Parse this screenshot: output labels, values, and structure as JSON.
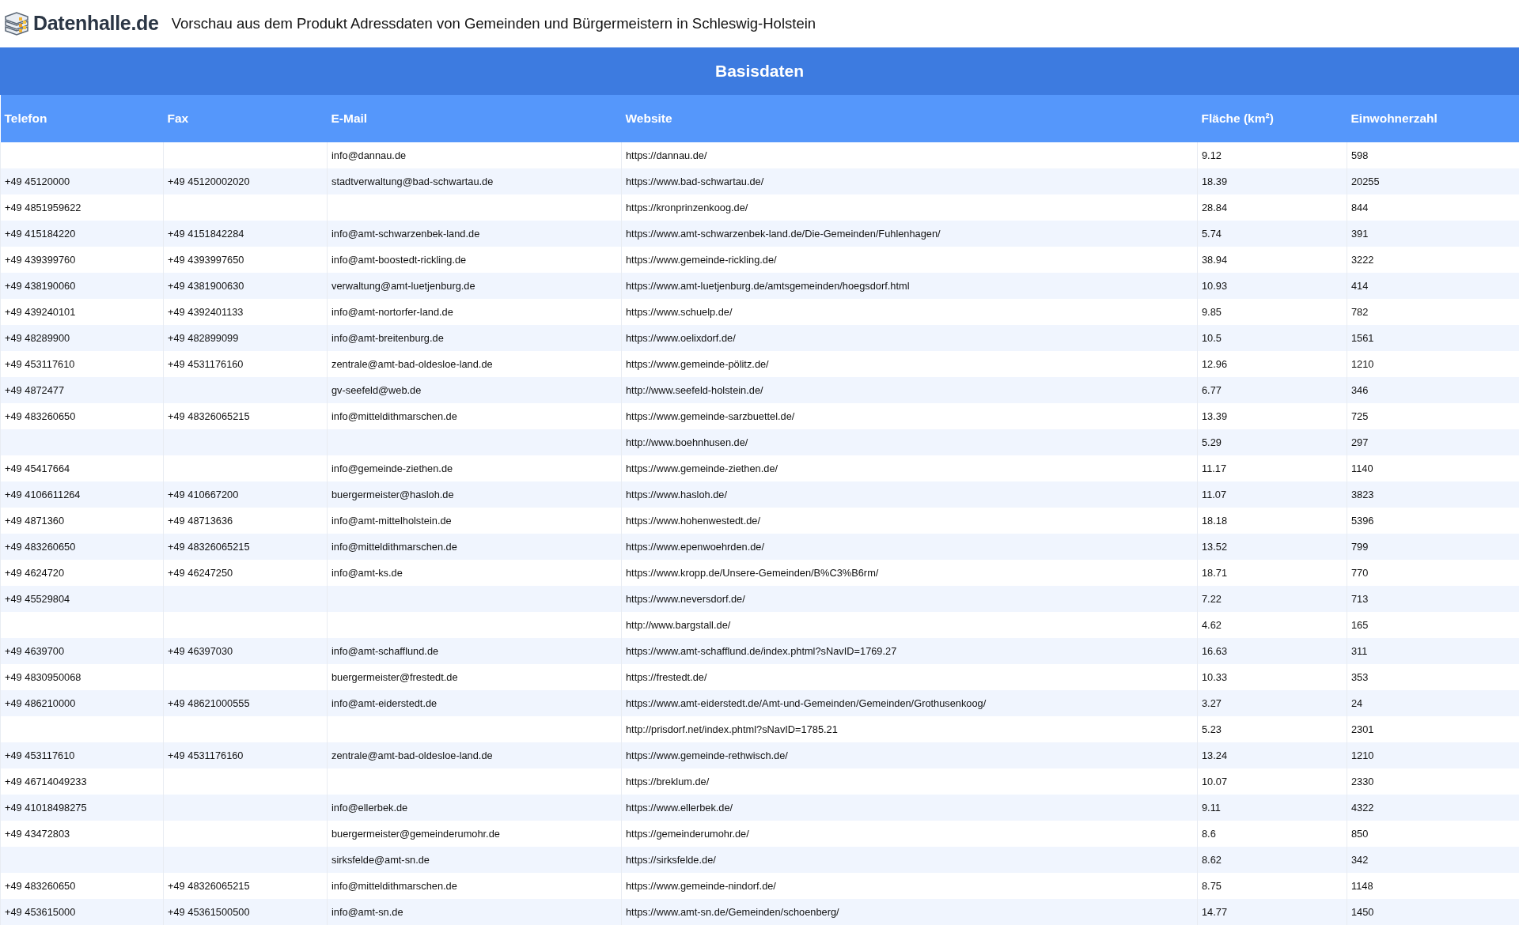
{
  "header": {
    "brand": "Datenhalle.de",
    "title": "Vorschau aus dem Produkt Adressdaten von Gemeinden und Bürgermeistern in Schleswig-Holstein"
  },
  "table": {
    "section_title": "Basisdaten",
    "columns": [
      "Telefon",
      "Fax",
      "E-Mail",
      "Website",
      "Fläche (km²)",
      "Einwohnerzahl"
    ],
    "rows": [
      [
        null,
        null,
        "info@dannau.de",
        "https://dannau.de/",
        "9.12",
        "598"
      ],
      [
        "+49 45120000",
        "+49 45120002020",
        "stadtverwaltung@bad-schwartau.de",
        "https://www.bad-schwartau.de/",
        "18.39",
        "20255"
      ],
      [
        "+49 4851959622",
        null,
        null,
        "https://kronprinzenkoog.de/",
        "28.84",
        "844"
      ],
      [
        "+49 415184220",
        "+49 4151842284",
        "info@amt-schwarzenbek-land.de",
        "https://www.amt-schwarzenbek-land.de/Die-Gemeinden/Fuhlenhagen/",
        "5.74",
        "391"
      ],
      [
        "+49 439399760",
        "+49 4393997650",
        "info@amt-boostedt-rickling.de",
        "https://www.gemeinde-rickling.de/",
        "38.94",
        "3222"
      ],
      [
        "+49 438190060",
        "+49 4381900630",
        "verwaltung@amt-luetjenburg.de",
        "https://www.amt-luetjenburg.de/amtsgemeinden/hoegsdorf.html",
        "10.93",
        "414"
      ],
      [
        "+49 439240101",
        "+49 4392401133",
        "info@amt-nortorfer-land.de",
        "https://www.schuelp.de/",
        "9.85",
        "782"
      ],
      [
        "+49 48289900",
        "+49 482899099",
        "info@amt-breitenburg.de",
        "https://www.oelixdorf.de/",
        "10.5",
        "1561"
      ],
      [
        "+49 453117610",
        "+49 4531176160",
        "zentrale@amt-bad-oldesloe-land.de",
        "https://www.gemeinde-pölitz.de/",
        "12.96",
        "1210"
      ],
      [
        "+49 4872477",
        null,
        "gv-seefeld@web.de",
        "http://www.seefeld-holstein.de/",
        "6.77",
        "346"
      ],
      [
        "+49 483260650",
        "+49 48326065215",
        "info@mitteldithmarschen.de",
        "https://www.gemeinde-sarzbuettel.de/",
        "13.39",
        "725"
      ],
      [
        null,
        null,
        null,
        "http://www.boehnhusen.de/",
        "5.29",
        "297"
      ],
      [
        "+49 45417664",
        null,
        "info@gemeinde-ziethen.de",
        "https://www.gemeinde-ziethen.de/",
        "11.17",
        "1140"
      ],
      [
        "+49 4106611264",
        "+49 410667200",
        "buergermeister@hasloh.de",
        "https://www.hasloh.de/",
        "11.07",
        "3823"
      ],
      [
        "+49 4871360",
        "+49 48713636",
        "info@amt-mittelholstein.de",
        "https://www.hohenwestedt.de/",
        "18.18",
        "5396"
      ],
      [
        "+49 483260650",
        "+49 48326065215",
        "info@mitteldithmarschen.de",
        "https://www.epenwoehrden.de/",
        "13.52",
        "799"
      ],
      [
        "+49 4624720",
        "+49 46247250",
        "info@amt-ks.de",
        "https://www.kropp.de/Unsere-Gemeinden/B%C3%B6rm/",
        "18.71",
        "770"
      ],
      [
        "+49 45529804",
        null,
        null,
        "https://www.neversdorf.de/",
        "7.22",
        "713"
      ],
      [
        null,
        null,
        null,
        "http://www.bargstall.de/",
        "4.62",
        "165"
      ],
      [
        "+49 4639700",
        "+49 46397030",
        "info@amt-schafflund.de",
        "https://www.amt-schafflund.de/index.phtml?sNavID=1769.27",
        "16.63",
        "311"
      ],
      [
        "+49 4830950068",
        null,
        "buergermeister@frestedt.de",
        "https://frestedt.de/",
        "10.33",
        "353"
      ],
      [
        "+49 486210000",
        "+49 48621000555",
        "info@amt-eiderstedt.de",
        "https://www.amt-eiderstedt.de/Amt-und-Gemeinden/Gemeinden/Grothusenkoog/",
        "3.27",
        "24"
      ],
      [
        null,
        null,
        null,
        "http://prisdorf.net/index.phtml?sNavID=1785.21",
        "5.23",
        "2301"
      ],
      [
        "+49 453117610",
        "+49 4531176160",
        "zentrale@amt-bad-oldesloe-land.de",
        "https://www.gemeinde-rethwisch.de/",
        "13.24",
        "1210"
      ],
      [
        "+49 46714049233",
        null,
        null,
        "https://breklum.de/",
        "10.07",
        "2330"
      ],
      [
        "+49 41018498275",
        null,
        "info@ellerbek.de",
        "https://www.ellerbek.de/",
        "9.11",
        "4322"
      ],
      [
        "+49 43472803",
        null,
        "buergermeister@gemeinderumohr.de",
        "https://gemeinderumohr.de/",
        "8.6",
        "850"
      ],
      [
        null,
        null,
        "sirksfelde@amt-sn.de",
        "https://sirksfelde.de/",
        "8.62",
        "342"
      ],
      [
        "+49 483260650",
        "+49 48326065215",
        "info@mitteldithmarschen.de",
        "https://www.gemeinde-nindorf.de/",
        "8.75",
        "1148"
      ],
      [
        "+49 453615000",
        "+49 45361500500",
        "info@amt-sn.de",
        "https://www.amt-sn.de/Gemeinden/schoenberg/",
        "14.77",
        "1450"
      ]
    ]
  }
}
